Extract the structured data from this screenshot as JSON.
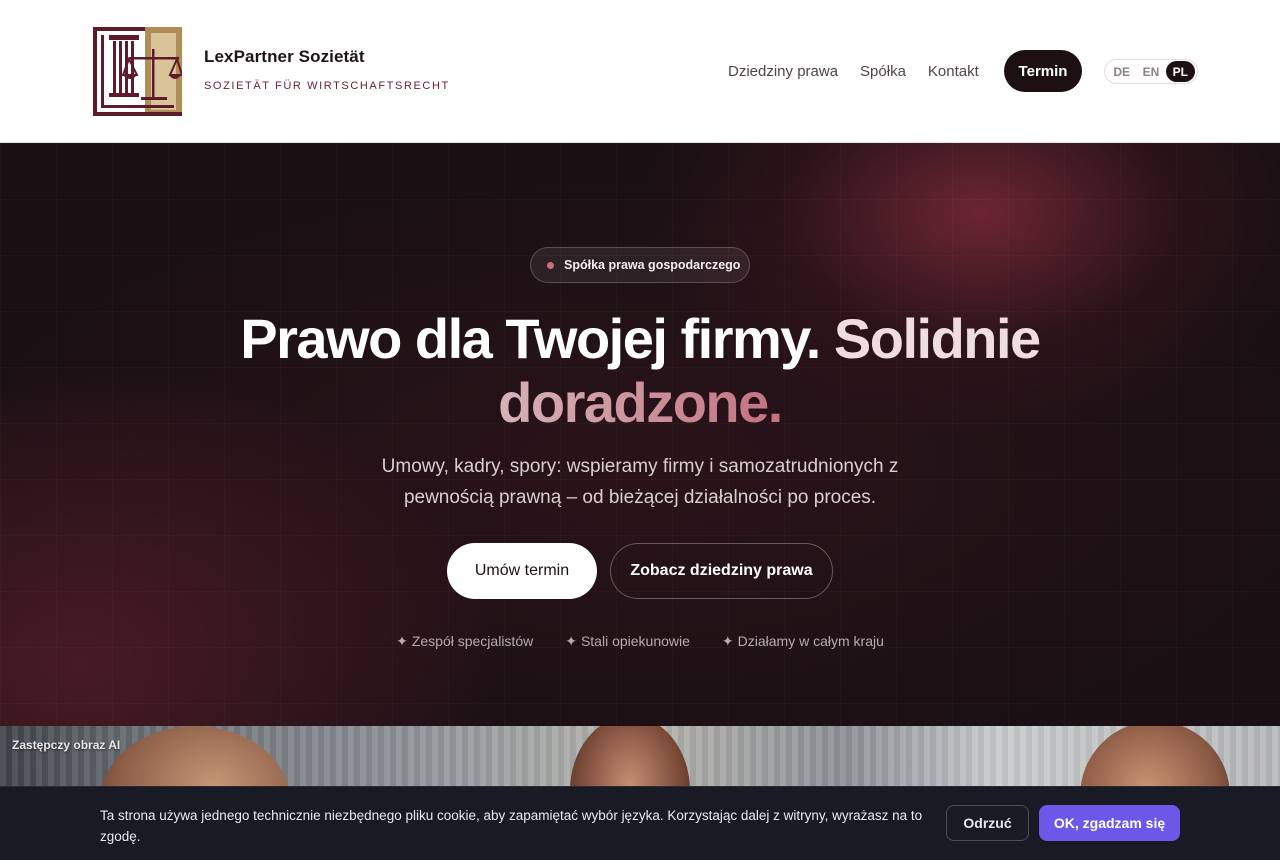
{
  "header": {
    "brand_name": "LexPartner Sozietät",
    "brand_sub": "SOZIETÄT FÜR WIRTSCHAFTSRECHT",
    "nav": [
      "Dziedziny prawa",
      "Spółka",
      "Kontakt"
    ],
    "cta": "Termin",
    "languages": [
      "DE",
      "EN",
      "PL"
    ],
    "active_language": "PL"
  },
  "hero": {
    "badge": "Spółka prawa gospodarczego",
    "title_main": "Prawo dla Twojej firmy.",
    "title_accent1": "Solidnie",
    "title_accent2": "doradzone.",
    "lead": "Umowy, kadry, spory: wspieramy firmy i samozatrudnionych z pewnością prawną – od bieżącej działalności po proces.",
    "primary_button": "Umów termin",
    "secondary_button": "Zobacz dziedziny prawa",
    "features": [
      "Zespół specjalistów",
      "Stali opiekunowie",
      "Działamy w całym kraju"
    ]
  },
  "photo": {
    "label": "Zastępczy obraz AI"
  },
  "cookie": {
    "text": "Ta strona używa jednego technicznie niezbędnego pliku cookie, aby zapamiętać wybór języka. Korzystając dalej z witryny, wyrażasz na to zgodę.",
    "reject": "Odrzuć",
    "accept": "OK, zgadzam się"
  },
  "colors": {
    "brand_dark": "#1c1013",
    "brand_wine": "#6a2330",
    "brand_gold": "#b08d57",
    "accept_purple": "#6b57e8"
  }
}
